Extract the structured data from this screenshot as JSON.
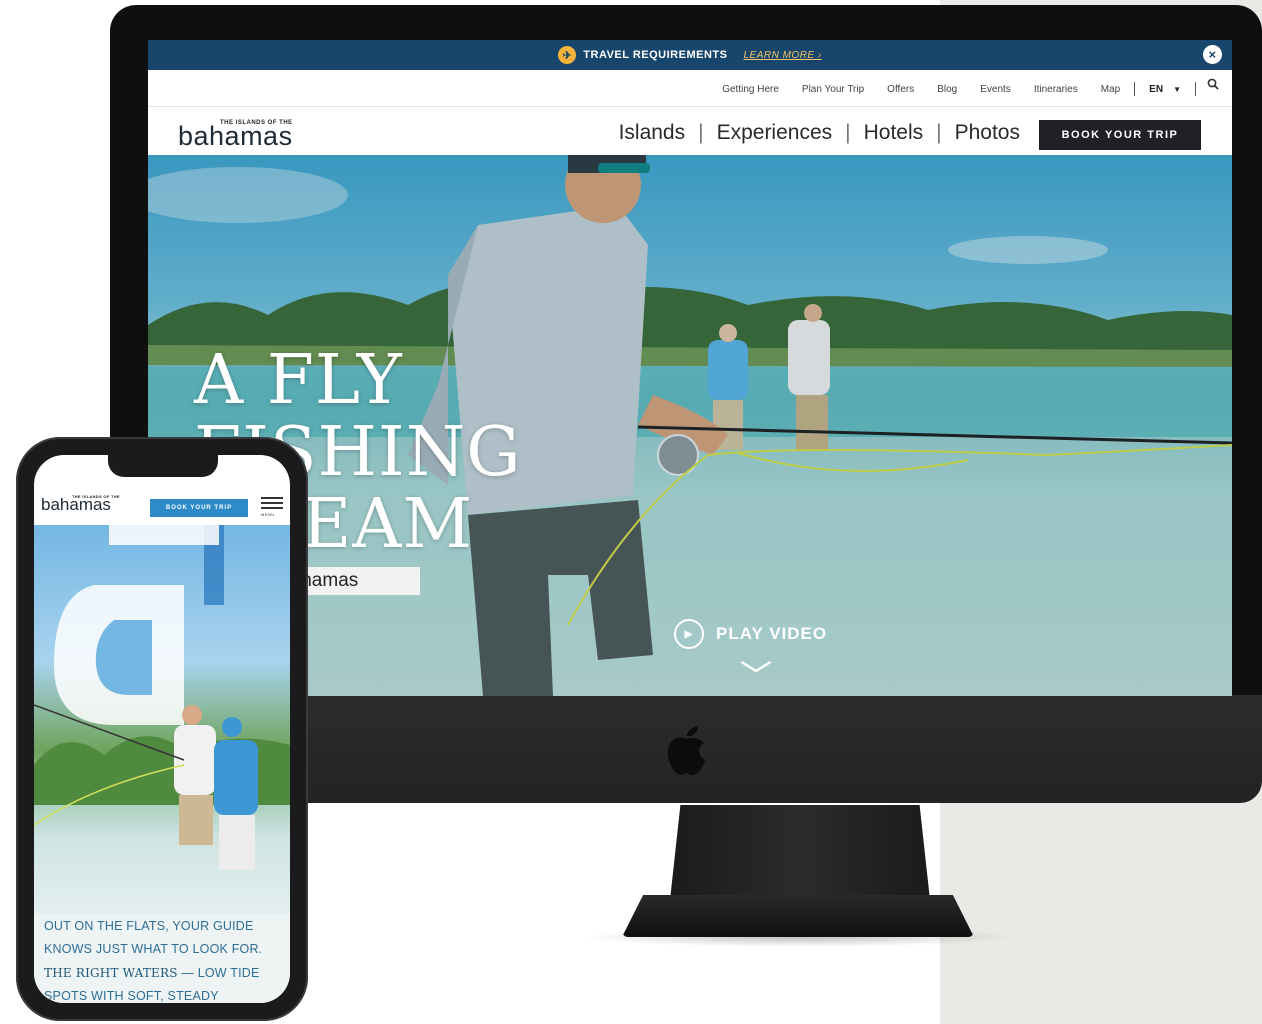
{
  "desktop": {
    "alert": {
      "icon": "airplane-icon",
      "text": "TRAVEL REQUIREMENTS",
      "link": "LEARN MORE ›",
      "close_icon": "close-icon"
    },
    "utility_nav": {
      "links": [
        "Getting Here",
        "Plan Your Trip",
        "Offers",
        "Blog",
        "Events",
        "Itineraries",
        "Map"
      ],
      "language": "EN",
      "search_icon": "search-icon"
    },
    "logo": {
      "small": "THE ISLANDS OF THE",
      "main": "bahamas"
    },
    "main_nav": {
      "links": [
        "Islands",
        "Experiences",
        "Hotels",
        "Photos"
      ],
      "cta": "BOOK YOUR TRIP"
    },
    "hero": {
      "title_lines": [
        "A FLY",
        "FISHING",
        "DREAM"
      ],
      "tag": "Bahamas",
      "play_label": "PLAY VIDEO",
      "scroll_icon": "chevron-down-icon"
    }
  },
  "mobile": {
    "logo": {
      "small": "THE ISLANDS OF THE",
      "main": "bahamas"
    },
    "cta": "BOOK YOUR TRIP",
    "menu_label": "MENU",
    "body_lines": [
      "OUT ON THE FLATS, YOUR GUIDE",
      "KNOWS JUST WHAT TO LOOK FOR.",
      "THE RIGHT WATERS",
      "— LOW TIDE",
      "SPOTS WITH SOFT, STEADY"
    ]
  },
  "colors": {
    "alert_bar": "#17456b",
    "accent_yellow": "#f4b23a",
    "cta_dark": "#1f2125",
    "cta_blue": "#2d8bc8",
    "mobile_text": "#2e6e95"
  }
}
